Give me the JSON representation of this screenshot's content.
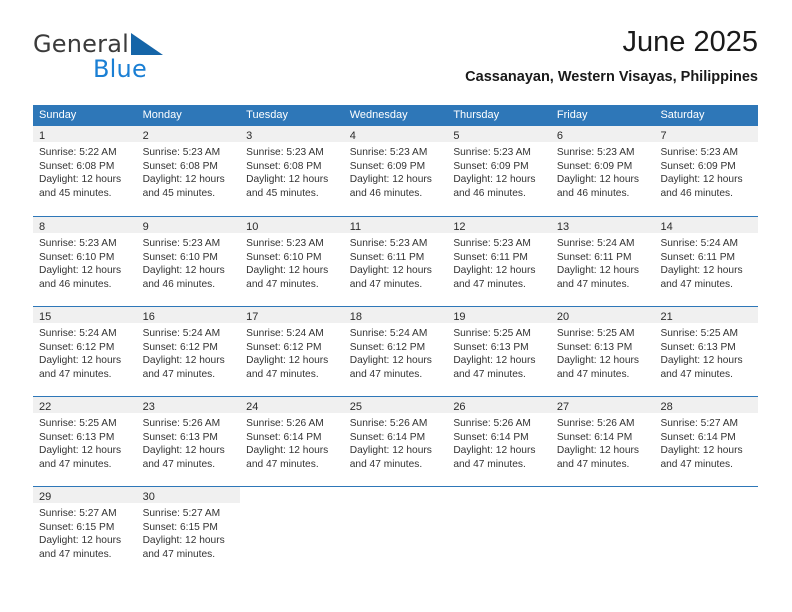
{
  "brand": {
    "name_top": "General",
    "name_bottom": "Blue",
    "logo_icon": "blue-flag-triangle-icon",
    "accent_color": "#1a7fd4",
    "text_color": "#3b3b3b"
  },
  "header": {
    "month_title": "June 2025",
    "location": "Cassanayan, Western Visayas, Philippines"
  },
  "calendar": {
    "header_color": "#2e77b8",
    "day_band_color": "#f0f0f0",
    "weekdays": [
      "Sunday",
      "Monday",
      "Tuesday",
      "Wednesday",
      "Thursday",
      "Friday",
      "Saturday"
    ],
    "weeks": [
      [
        {
          "day": "1",
          "sunrise": "Sunrise: 5:22 AM",
          "sunset": "Sunset: 6:08 PM",
          "daylight_line1": "Daylight: 12 hours",
          "daylight_line2": "and 45 minutes."
        },
        {
          "day": "2",
          "sunrise": "Sunrise: 5:23 AM",
          "sunset": "Sunset: 6:08 PM",
          "daylight_line1": "Daylight: 12 hours",
          "daylight_line2": "and 45 minutes."
        },
        {
          "day": "3",
          "sunrise": "Sunrise: 5:23 AM",
          "sunset": "Sunset: 6:08 PM",
          "daylight_line1": "Daylight: 12 hours",
          "daylight_line2": "and 45 minutes."
        },
        {
          "day": "4",
          "sunrise": "Sunrise: 5:23 AM",
          "sunset": "Sunset: 6:09 PM",
          "daylight_line1": "Daylight: 12 hours",
          "daylight_line2": "and 46 minutes."
        },
        {
          "day": "5",
          "sunrise": "Sunrise: 5:23 AM",
          "sunset": "Sunset: 6:09 PM",
          "daylight_line1": "Daylight: 12 hours",
          "daylight_line2": "and 46 minutes."
        },
        {
          "day": "6",
          "sunrise": "Sunrise: 5:23 AM",
          "sunset": "Sunset: 6:09 PM",
          "daylight_line1": "Daylight: 12 hours",
          "daylight_line2": "and 46 minutes."
        },
        {
          "day": "7",
          "sunrise": "Sunrise: 5:23 AM",
          "sunset": "Sunset: 6:09 PM",
          "daylight_line1": "Daylight: 12 hours",
          "daylight_line2": "and 46 minutes."
        }
      ],
      [
        {
          "day": "8",
          "sunrise": "Sunrise: 5:23 AM",
          "sunset": "Sunset: 6:10 PM",
          "daylight_line1": "Daylight: 12 hours",
          "daylight_line2": "and 46 minutes."
        },
        {
          "day": "9",
          "sunrise": "Sunrise: 5:23 AM",
          "sunset": "Sunset: 6:10 PM",
          "daylight_line1": "Daylight: 12 hours",
          "daylight_line2": "and 46 minutes."
        },
        {
          "day": "10",
          "sunrise": "Sunrise: 5:23 AM",
          "sunset": "Sunset: 6:10 PM",
          "daylight_line1": "Daylight: 12 hours",
          "daylight_line2": "and 47 minutes."
        },
        {
          "day": "11",
          "sunrise": "Sunrise: 5:23 AM",
          "sunset": "Sunset: 6:11 PM",
          "daylight_line1": "Daylight: 12 hours",
          "daylight_line2": "and 47 minutes."
        },
        {
          "day": "12",
          "sunrise": "Sunrise: 5:23 AM",
          "sunset": "Sunset: 6:11 PM",
          "daylight_line1": "Daylight: 12 hours",
          "daylight_line2": "and 47 minutes."
        },
        {
          "day": "13",
          "sunrise": "Sunrise: 5:24 AM",
          "sunset": "Sunset: 6:11 PM",
          "daylight_line1": "Daylight: 12 hours",
          "daylight_line2": "and 47 minutes."
        },
        {
          "day": "14",
          "sunrise": "Sunrise: 5:24 AM",
          "sunset": "Sunset: 6:11 PM",
          "daylight_line1": "Daylight: 12 hours",
          "daylight_line2": "and 47 minutes."
        }
      ],
      [
        {
          "day": "15",
          "sunrise": "Sunrise: 5:24 AM",
          "sunset": "Sunset: 6:12 PM",
          "daylight_line1": "Daylight: 12 hours",
          "daylight_line2": "and 47 minutes."
        },
        {
          "day": "16",
          "sunrise": "Sunrise: 5:24 AM",
          "sunset": "Sunset: 6:12 PM",
          "daylight_line1": "Daylight: 12 hours",
          "daylight_line2": "and 47 minutes."
        },
        {
          "day": "17",
          "sunrise": "Sunrise: 5:24 AM",
          "sunset": "Sunset: 6:12 PM",
          "daylight_line1": "Daylight: 12 hours",
          "daylight_line2": "and 47 minutes."
        },
        {
          "day": "18",
          "sunrise": "Sunrise: 5:24 AM",
          "sunset": "Sunset: 6:12 PM",
          "daylight_line1": "Daylight: 12 hours",
          "daylight_line2": "and 47 minutes."
        },
        {
          "day": "19",
          "sunrise": "Sunrise: 5:25 AM",
          "sunset": "Sunset: 6:13 PM",
          "daylight_line1": "Daylight: 12 hours",
          "daylight_line2": "and 47 minutes."
        },
        {
          "day": "20",
          "sunrise": "Sunrise: 5:25 AM",
          "sunset": "Sunset: 6:13 PM",
          "daylight_line1": "Daylight: 12 hours",
          "daylight_line2": "and 47 minutes."
        },
        {
          "day": "21",
          "sunrise": "Sunrise: 5:25 AM",
          "sunset": "Sunset: 6:13 PM",
          "daylight_line1": "Daylight: 12 hours",
          "daylight_line2": "and 47 minutes."
        }
      ],
      [
        {
          "day": "22",
          "sunrise": "Sunrise: 5:25 AM",
          "sunset": "Sunset: 6:13 PM",
          "daylight_line1": "Daylight: 12 hours",
          "daylight_line2": "and 47 minutes."
        },
        {
          "day": "23",
          "sunrise": "Sunrise: 5:26 AM",
          "sunset": "Sunset: 6:13 PM",
          "daylight_line1": "Daylight: 12 hours",
          "daylight_line2": "and 47 minutes."
        },
        {
          "day": "24",
          "sunrise": "Sunrise: 5:26 AM",
          "sunset": "Sunset: 6:14 PM",
          "daylight_line1": "Daylight: 12 hours",
          "daylight_line2": "and 47 minutes."
        },
        {
          "day": "25",
          "sunrise": "Sunrise: 5:26 AM",
          "sunset": "Sunset: 6:14 PM",
          "daylight_line1": "Daylight: 12 hours",
          "daylight_line2": "and 47 minutes."
        },
        {
          "day": "26",
          "sunrise": "Sunrise: 5:26 AM",
          "sunset": "Sunset: 6:14 PM",
          "daylight_line1": "Daylight: 12 hours",
          "daylight_line2": "and 47 minutes."
        },
        {
          "day": "27",
          "sunrise": "Sunrise: 5:26 AM",
          "sunset": "Sunset: 6:14 PM",
          "daylight_line1": "Daylight: 12 hours",
          "daylight_line2": "and 47 minutes."
        },
        {
          "day": "28",
          "sunrise": "Sunrise: 5:27 AM",
          "sunset": "Sunset: 6:14 PM",
          "daylight_line1": "Daylight: 12 hours",
          "daylight_line2": "and 47 minutes."
        }
      ],
      [
        {
          "day": "29",
          "sunrise": "Sunrise: 5:27 AM",
          "sunset": "Sunset: 6:15 PM",
          "daylight_line1": "Daylight: 12 hours",
          "daylight_line2": "and 47 minutes."
        },
        {
          "day": "30",
          "sunrise": "Sunrise: 5:27 AM",
          "sunset": "Sunset: 6:15 PM",
          "daylight_line1": "Daylight: 12 hours",
          "daylight_line2": "and 47 minutes."
        },
        {
          "day": "",
          "sunrise": "",
          "sunset": "",
          "daylight_line1": "",
          "daylight_line2": ""
        },
        {
          "day": "",
          "sunrise": "",
          "sunset": "",
          "daylight_line1": "",
          "daylight_line2": ""
        },
        {
          "day": "",
          "sunrise": "",
          "sunset": "",
          "daylight_line1": "",
          "daylight_line2": ""
        },
        {
          "day": "",
          "sunrise": "",
          "sunset": "",
          "daylight_line1": "",
          "daylight_line2": ""
        },
        {
          "day": "",
          "sunrise": "",
          "sunset": "",
          "daylight_line1": "",
          "daylight_line2": ""
        }
      ]
    ]
  }
}
